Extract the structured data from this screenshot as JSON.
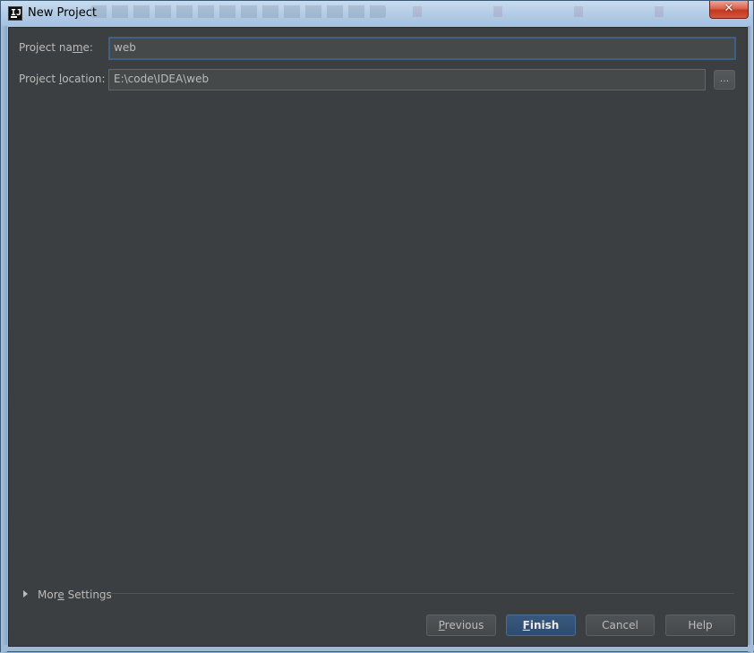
{
  "window": {
    "title": "New Project",
    "close_glyph": "✕",
    "icon_text": "IJ"
  },
  "form": {
    "project_name_label_pre": "Project na",
    "project_name_label_mn": "m",
    "project_name_label_post": "e:",
    "project_name_value": "web",
    "project_location_label_pre": "Project ",
    "project_location_label_mn": "l",
    "project_location_label_post": "ocation:",
    "project_location_value": "E:\\code\\IDEA\\web",
    "browse_label": "..."
  },
  "more_settings": {
    "label_pre": "Mor",
    "label_mn": "e",
    "label_post": " Settings",
    "expanded": false
  },
  "buttons": {
    "previous_mn": "P",
    "previous_rest": "revious",
    "finish_mn": "F",
    "finish_rest": "inish",
    "cancel": "Cancel",
    "help": "Help"
  },
  "colors": {
    "background": "#3c3f41",
    "field": "#45494a",
    "text": "#bbbbbb",
    "focus": "#3d6185",
    "primary_button": "#365880"
  }
}
